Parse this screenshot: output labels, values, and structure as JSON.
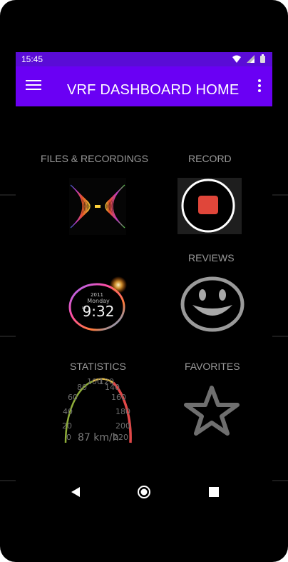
{
  "status_bar": {
    "time": "15:45",
    "icons": [
      "wifi-icon",
      "cell-signal-icon",
      "battery-icon"
    ]
  },
  "app_bar": {
    "menu_icon": "hamburger-menu-icon",
    "title": "VRF DASHBOARD HOME",
    "overflow_icon": "more-vert-icon",
    "color": "#6a00f4"
  },
  "dashboard": {
    "files_label": "FILES & RECORDINGS",
    "record_label": "RECORD",
    "reviews_label": "REVIEWS",
    "statistics_label": "STATISTICS",
    "favorites_label": "FAVORITES",
    "clock_widget": {
      "year": "2011",
      "day": "Monday",
      "ampm": "PM",
      "time": "9:32"
    },
    "speedometer": {
      "ticks": [
        "0",
        "20",
        "40",
        "60",
        "80",
        "100",
        "120",
        "140",
        "160",
        "180",
        "200",
        "220"
      ],
      "speed": "87 km/h"
    }
  },
  "nav_bar": {
    "icons": [
      "back-icon",
      "home-icon",
      "recents-icon"
    ]
  },
  "colors": {
    "background": "#000000",
    "label_grey": "#9a9a9a",
    "record_red": "#e0463a"
  }
}
